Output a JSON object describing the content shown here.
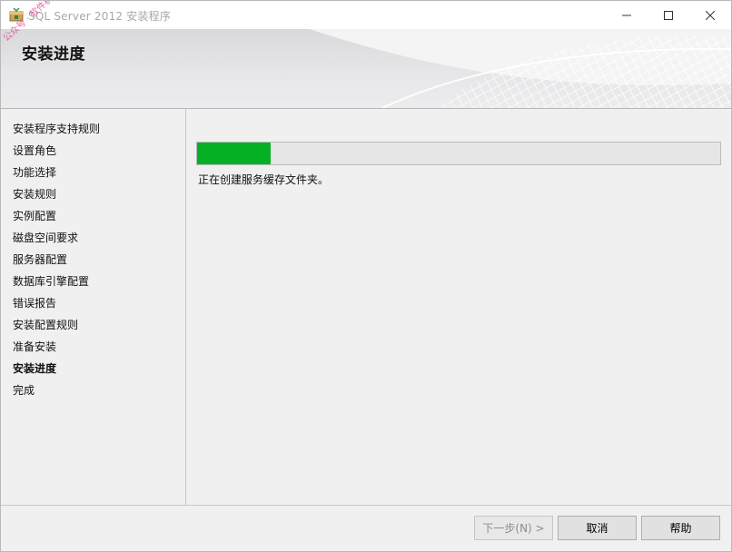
{
  "window": {
    "title": "SQL Server 2012 安装程序",
    "icon": "sql-server-setup-icon",
    "watermark": "公众号 · 软件机构"
  },
  "banner": {
    "title": "安装进度"
  },
  "nav": {
    "items": [
      {
        "label": "安装程序支持规则",
        "active": false
      },
      {
        "label": "设置角色",
        "active": false
      },
      {
        "label": "功能选择",
        "active": false
      },
      {
        "label": "安装规则",
        "active": false
      },
      {
        "label": "实例配置",
        "active": false
      },
      {
        "label": "磁盘空间要求",
        "active": false
      },
      {
        "label": "服务器配置",
        "active": false
      },
      {
        "label": "数据库引擎配置",
        "active": false
      },
      {
        "label": "错误报告",
        "active": false
      },
      {
        "label": "安装配置规则",
        "active": false
      },
      {
        "label": "准备安装",
        "active": false
      },
      {
        "label": "安装进度",
        "active": true
      },
      {
        "label": "完成",
        "active": false
      }
    ]
  },
  "progress": {
    "fraction": 0.14,
    "fill_color": "#06b025",
    "status": "正在创建服务缓存文件夹。"
  },
  "buttons": {
    "next": "下一步(N) >",
    "cancel": "取消",
    "help": "帮助"
  }
}
